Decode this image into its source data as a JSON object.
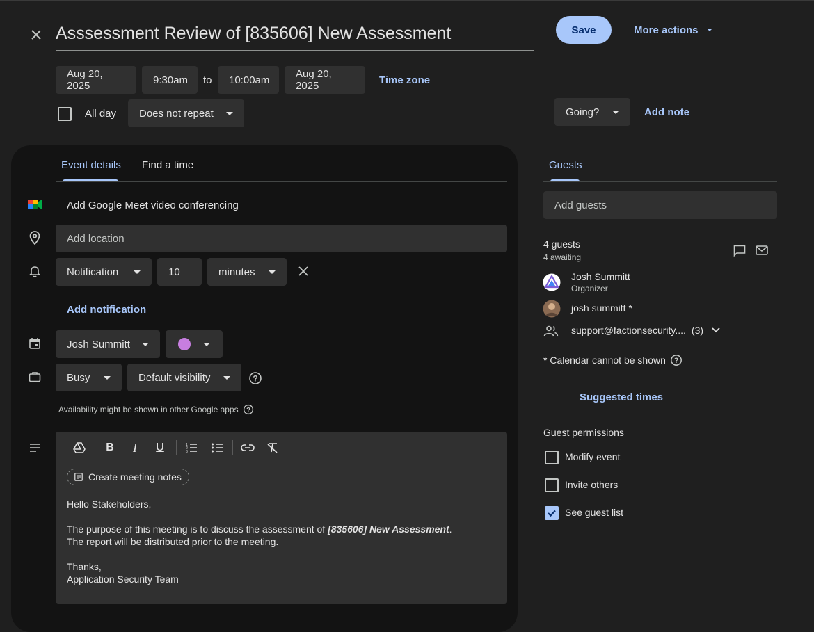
{
  "header": {
    "title": "Asssessment Review of [835606] New Assessment",
    "save_label": "Save",
    "more_actions_label": "More actions"
  },
  "datetime": {
    "start_date": "Aug 20, 2025",
    "start_time": "9:30am",
    "to_label": "to",
    "end_time": "10:00am",
    "end_date": "Aug 20, 2025",
    "time_zone_label": "Time zone",
    "all_day_label": "All day",
    "repeat_value": "Does not repeat"
  },
  "rsvp": {
    "going_label": "Going?",
    "add_note_label": "Add note"
  },
  "tabs": {
    "event_details": "Event details",
    "find_a_time": "Find a time",
    "guests": "Guests"
  },
  "details": {
    "meet_label": "Add Google Meet video conferencing",
    "location_placeholder": "Add location",
    "notification_type": "Notification",
    "notification_amount": "10",
    "notification_unit": "minutes",
    "add_notification_label": "Add notification",
    "calendar_owner": "Josh Summitt",
    "event_color": "#c77ee0",
    "busy_value": "Busy",
    "visibility_value": "Default visibility",
    "availability_note": "Availability might be shown in other Google apps"
  },
  "editor": {
    "create_notes_label": "Create meeting notes",
    "greeting": "Hello Stakeholders,",
    "body_prefix": "The purpose of this meeting is to discuss the assessment of ",
    "body_bold": "[835606] New Assessment",
    "body_suffix": ".",
    "body_line2": "The report will be distributed prior to the meeting.",
    "sign_thanks": "Thanks,",
    "sign_team": "Application Security Team"
  },
  "guests": {
    "add_placeholder": "Add guests",
    "count": "4 guests",
    "awaiting": "4 awaiting",
    "list": [
      {
        "name": "Josh Summitt",
        "role": "Organizer"
      },
      {
        "name": "josh summitt *",
        "role": ""
      },
      {
        "name": "support@factionsecurity....",
        "role": "(3)"
      }
    ],
    "calendar_note": "* Calendar cannot be shown",
    "suggested_times": "Suggested times",
    "permissions_title": "Guest permissions",
    "permissions": [
      {
        "label": "Modify event",
        "checked": false
      },
      {
        "label": "Invite others",
        "checked": false
      },
      {
        "label": "See guest list",
        "checked": true
      }
    ]
  },
  "colors": {
    "accent": "#a8c7fa",
    "background": "#1f1f1f",
    "panel": "#131313",
    "chip": "#303030"
  }
}
